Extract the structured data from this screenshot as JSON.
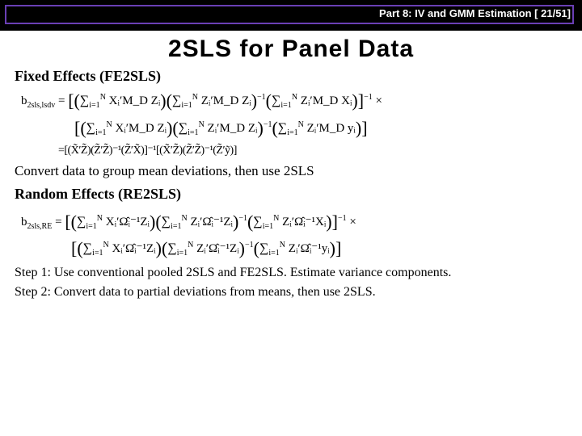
{
  "header": {
    "breadcrumb": "Part 8: IV and GMM Estimation [ 21/51]"
  },
  "title": "2SLS for Panel Data",
  "sections": {
    "fe_heading": "Fixed Effects (FE2SLS)",
    "re_heading": "Random Effects (RE2SLS)"
  },
  "eq": {
    "b_lsdv_lhs": "b",
    "b_lsdv_sub": "2sls,lsdv",
    "fe_line1_a": "∑",
    "fe_line1_a_sub": "i=1",
    "fe_line1_a_sup": "N",
    "fe_core1": "Xᵢ′M_D Zᵢ",
    "fe_core2": "Zᵢ′M_D Zᵢ",
    "fe_core3": "Zᵢ′M_D Xᵢ",
    "fe_core4": "Zᵢ′M_D yᵢ",
    "fe_line3": "=[(X̃′Z̃)(Z̃′Z̃)⁻¹(Z̃′X̃)]⁻¹[(X̃′Z̃)(Z̃′Z̃)⁻¹(Z̃′ỹ)]",
    "convert_text": "Convert data to group mean deviations, then use 2SLS",
    "b_re_lhs": "b",
    "b_re_sub": "2sls,RE",
    "re_core1": "Xᵢ′Ω̂ᵢ⁻¹Zᵢ",
    "re_core2": "Zᵢ′Ω̂ᵢ⁻¹Zᵢ",
    "re_core3": "Zᵢ′Ω̂ᵢ⁻¹Xᵢ",
    "re_core4": "Zᵢ′Ω̂ᵢ⁻¹yᵢ",
    "step1": "Step 1: Use conventional pooled 2SLS and FE2SLS.  Estimate variance components.",
    "step2": "Step 2: Convert data to partial deviations from means, then use 2SLS."
  }
}
